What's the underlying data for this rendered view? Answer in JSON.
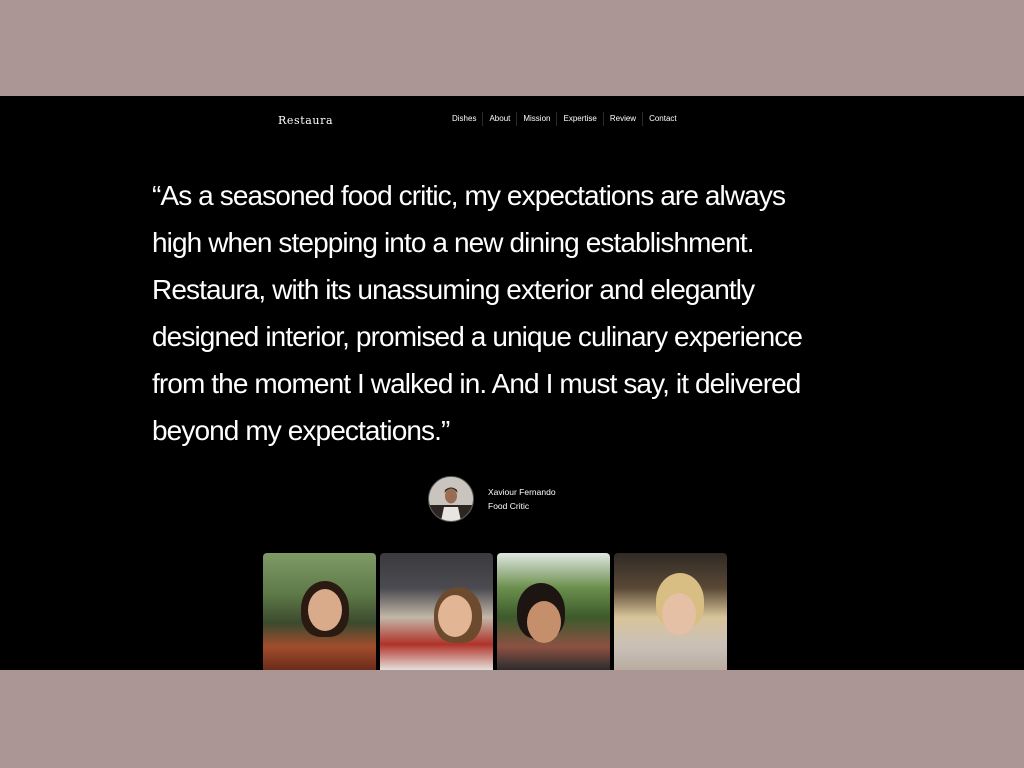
{
  "brand": {
    "name": "Restaura"
  },
  "nav": {
    "items": [
      {
        "label": "Dishes"
      },
      {
        "label": "About"
      },
      {
        "label": "Mission"
      },
      {
        "label": "Expertise"
      },
      {
        "label": "Review"
      },
      {
        "label": "Contact"
      }
    ]
  },
  "review": {
    "quote": "“As a seasoned food critic, my expectations are always high when stepping into a new dining establishment. Restaura, with its unassuming exterior and elegantly designed interior, promised a unique culinary experience from the moment I walked in. And I must say, it delivered beyond my expectations.”",
    "author_name": "Xaviour Fernando",
    "author_role": "Food Critic"
  },
  "colors": {
    "page_background": "#ab9695",
    "section_background": "#000000",
    "text": "#ffffff"
  }
}
